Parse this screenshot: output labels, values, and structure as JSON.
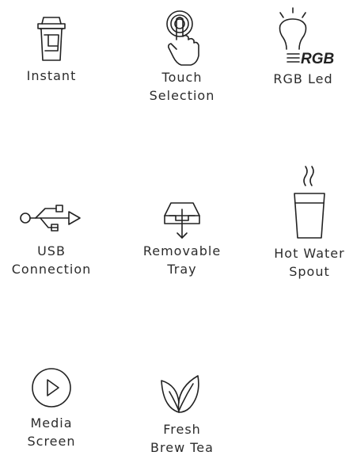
{
  "features": [
    {
      "icon": "cup-icon",
      "line1": "Instant",
      "line2": ""
    },
    {
      "icon": "touch-hand-icon",
      "line1": "Touch",
      "line2": "Selection"
    },
    {
      "icon": "rgb-bulb-icon",
      "line1": "RGB Led",
      "line2": "",
      "icon_text": "RGB"
    },
    {
      "icon": "usb-icon",
      "line1": "USB",
      "line2": "Connection"
    },
    {
      "icon": "tray-icon",
      "line1": "Removable",
      "line2": "Tray"
    },
    {
      "icon": "hot-cup-icon",
      "line1": "Hot Water",
      "line2": "Spout"
    },
    {
      "icon": "play-icon",
      "line1": "Media",
      "line2": "Screen"
    },
    {
      "icon": "leaves-icon",
      "line1": "Fresh",
      "line2": "Brew Tea"
    }
  ]
}
